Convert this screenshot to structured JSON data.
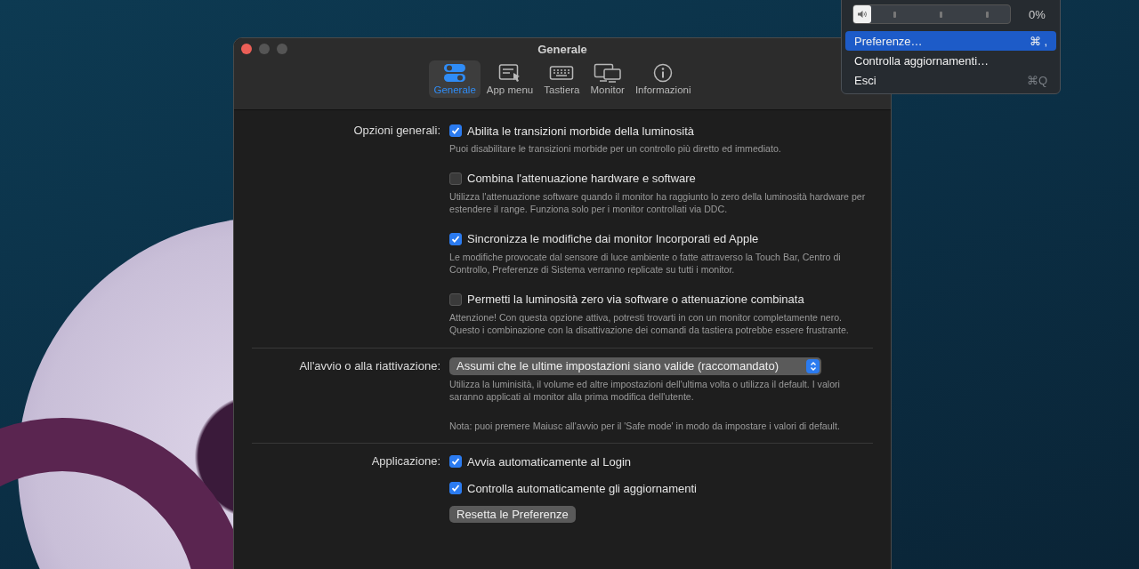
{
  "menu": {
    "volume": {
      "level": 0,
      "reading": "0%"
    },
    "items": [
      {
        "label": "Preferenze…",
        "shortcut": "⌘ ,",
        "selected": true
      },
      {
        "label": "Controlla aggiornamenti…",
        "selected": false
      },
      {
        "label": "Esci",
        "shortcut": "⌘Q",
        "selected": false
      }
    ]
  },
  "window": {
    "title": "Generale"
  },
  "toolbar": [
    {
      "label": "Generale",
      "selected": true
    },
    {
      "label": "App menu",
      "selected": false
    },
    {
      "label": "Tastiera",
      "selected": false
    },
    {
      "label": "Monitor",
      "selected": false
    },
    {
      "label": "Informazioni",
      "selected": false
    }
  ],
  "sections": [
    {
      "label": "Opzioni generali:",
      "items": [
        {
          "kind": "checkbox",
          "label": "Abilita le transizioni morbide della luminosità",
          "checked": true,
          "description": "Puoi disabilitare le transizioni morbide per un controllo più diretto ed immediato."
        },
        {
          "kind": "checkbox",
          "label": "Combina l'attenuazione hardware e software",
          "checked": false,
          "description": "Utilizza l'attenuazione software quando il monitor ha raggiunto lo zero della luminosità hardware per estendere il range. Funziona solo per i monitor controllati via DDC."
        },
        {
          "kind": "checkbox",
          "label": "Sincronizza le modifiche dai monitor Incorporati ed Apple",
          "checked": true,
          "description": "Le modifiche provocate dal sensore di luce ambiente o fatte attraverso la Touch Bar, Centro di Controllo, Preferenze di Sistema verranno replicate su tutti i monitor."
        },
        {
          "kind": "checkbox",
          "label": "Permetti la luminosità zero via software o attenuazione combinata",
          "checked": false,
          "description": "Attenzione! Con questa opzione attiva, potresti trovarti in con un monitor completamente nero. Questo i combinazione con la disattivazione dei comandi da tastiera potrebbe essere frustrante."
        }
      ]
    },
    {
      "label": "All'avvio o alla riattivazione:",
      "items": [
        {
          "kind": "popup",
          "value": "Assumi che le ultime impostazioni siano valide (raccomandato)",
          "description": "Utilizza la luminisità, il volume ed altre impostazioni dell'ultima volta o utilizza il default. I valori saranno applicati al monitor alla prima modifica dell'utente.",
          "note": "Nota: puoi premere Maiusc all'avvio per il 'Safe mode' in modo da impostare i valori di default."
        }
      ]
    },
    {
      "label": "Applicazione:",
      "items": [
        {
          "kind": "checkbox",
          "label": "Avvia automaticamente al Login",
          "checked": true
        },
        {
          "kind": "checkbox",
          "label": "Controlla automaticamente gli aggiornamenti",
          "checked": true
        },
        {
          "kind": "button",
          "label": "Resetta le Preferenze"
        }
      ]
    }
  ]
}
